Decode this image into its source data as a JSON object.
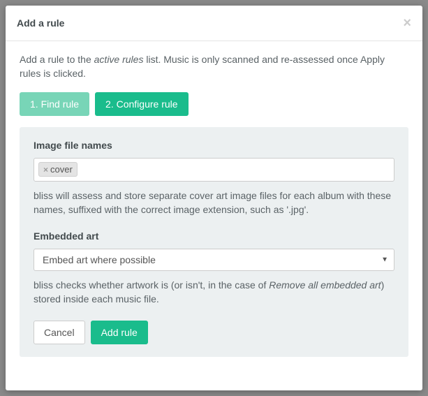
{
  "modal": {
    "title": "Add a rule",
    "description_pre": "Add a rule to the ",
    "description_em": "active rules",
    "description_post": " list. Music is only scanned and re-assessed once Apply rules is clicked."
  },
  "steps": {
    "step1": "1. Find rule",
    "step2": "2. Configure rule"
  },
  "image_names": {
    "label": "Image file names",
    "tag_value": "cover",
    "help": "bliss will assess and store separate cover art image files for each album with these names, suffixed with the correct image extension, such as '.jpg'."
  },
  "embedded_art": {
    "label": "Embedded art",
    "selected": "Embed art where possible",
    "help_pre": "bliss checks whether artwork is (or isn't, in the case of ",
    "help_em": "Remove all embedded art",
    "help_post": ") stored inside each music file."
  },
  "buttons": {
    "cancel": "Cancel",
    "add": "Add rule"
  }
}
